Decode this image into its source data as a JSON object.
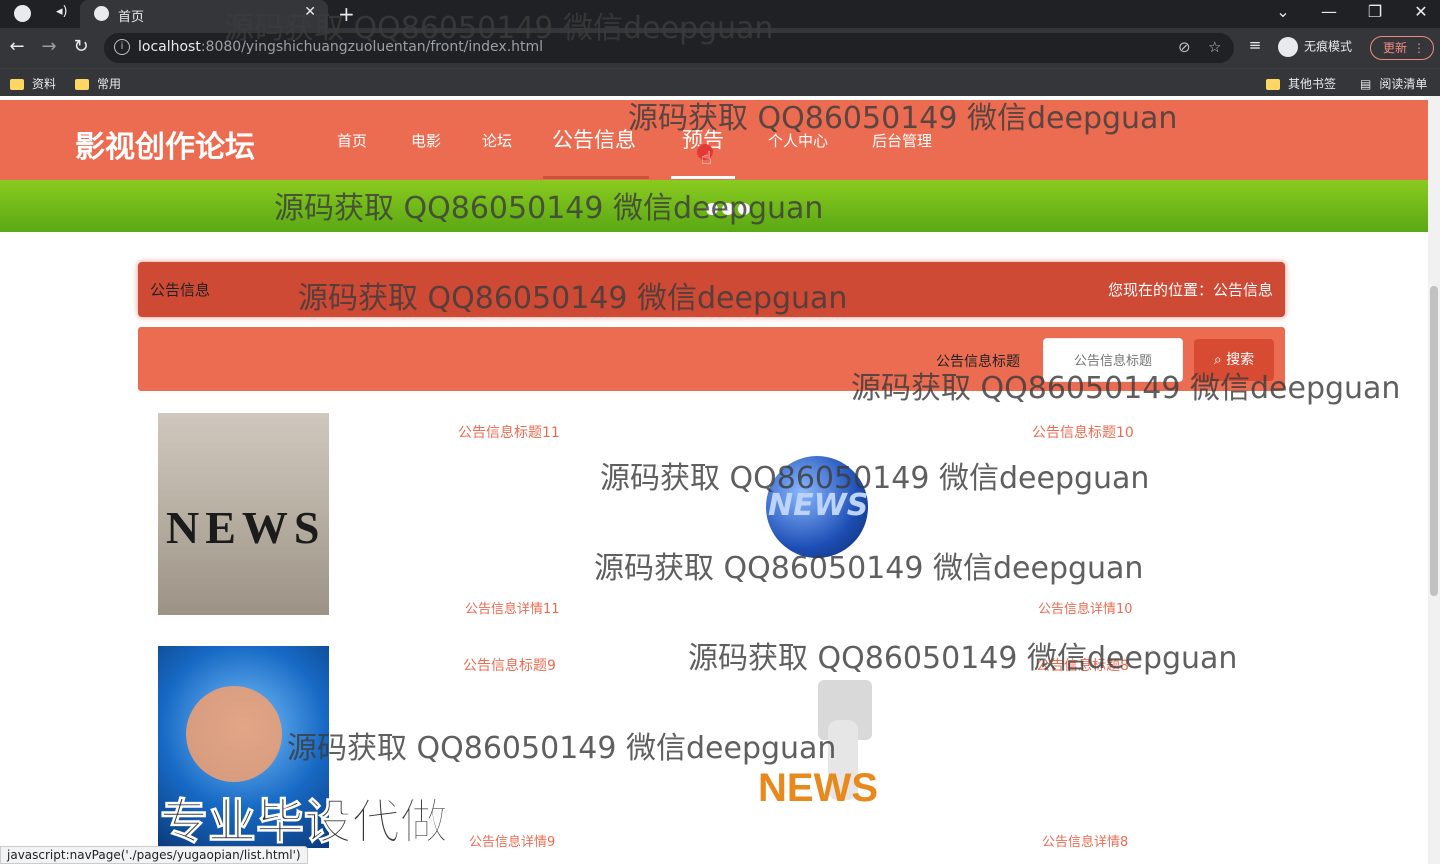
{
  "browser": {
    "tab_title": "首页",
    "new_tab": "+",
    "url_host": "localhost",
    "url_rest": ":8080/yingshichuangzuoluentan/front/index.html",
    "incognito_label": "无痕模式",
    "update_label": "更新",
    "bookmarks": [
      "资料",
      "常用"
    ],
    "other_bookmarks": "其他书签",
    "reading_list": "阅读清单",
    "status_url": "javascript:navPage('./pages/yugaopian/list.html')"
  },
  "site": {
    "title": "影视创作论坛",
    "nav": [
      "首页",
      "电影",
      "论坛",
      "公告信息",
      "预告",
      "个人中心",
      "后台管理"
    ]
  },
  "breadcrumb": {
    "left": "公告信息",
    "right": "您现在的位置：公告信息"
  },
  "search": {
    "label": "公告信息标题",
    "placeholder": "公告信息标题",
    "button": "搜索"
  },
  "items": [
    {
      "title": "公告信息标题11",
      "detail": "公告信息详情11",
      "image": "news-cubes-image"
    },
    {
      "title": "公告信息标题10",
      "detail": "公告信息详情10",
      "image": "news-globe-image"
    },
    {
      "title": "公告信息标题9",
      "detail": "公告信息详情9",
      "image": "news-world-image"
    },
    {
      "title": "公告信息标题8",
      "detail": "公告信息详情8",
      "image": "news-reader-image"
    }
  ],
  "watermark": "源码获取 QQ86050149 微信deepguan",
  "ad_text": "专业毕设代做",
  "colors": {
    "header": "#ec6c52",
    "crumb": "#cf4a34",
    "banner": "#6ab81a",
    "accent_text": "#ec6c52"
  }
}
